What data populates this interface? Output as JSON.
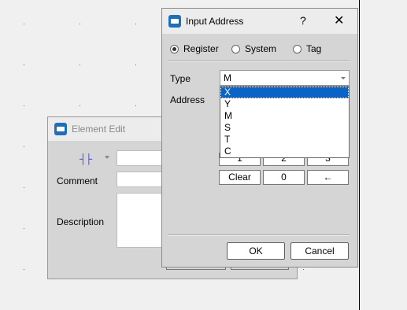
{
  "element_edit": {
    "title": "Element Edit",
    "contact_symbol": "┤├",
    "comment_label": "Comment",
    "description_label": "Description"
  },
  "input_address": {
    "title": "Input Address",
    "help": "?",
    "close": "✕",
    "radios": [
      {
        "label": "Register",
        "checked": true
      },
      {
        "label": "System",
        "checked": false
      },
      {
        "label": "Tag",
        "checked": false
      }
    ],
    "type_label": "Type",
    "type_value": "M",
    "address_label": "Address",
    "dropdown_options": [
      "X",
      "Y",
      "M",
      "S",
      "T",
      "C"
    ],
    "keypad_partial": [
      "1",
      "2",
      "3"
    ],
    "keypad_row": [
      "Clear",
      "0",
      "←"
    ],
    "ok_label": "OK",
    "cancel_label": "Cancel"
  }
}
